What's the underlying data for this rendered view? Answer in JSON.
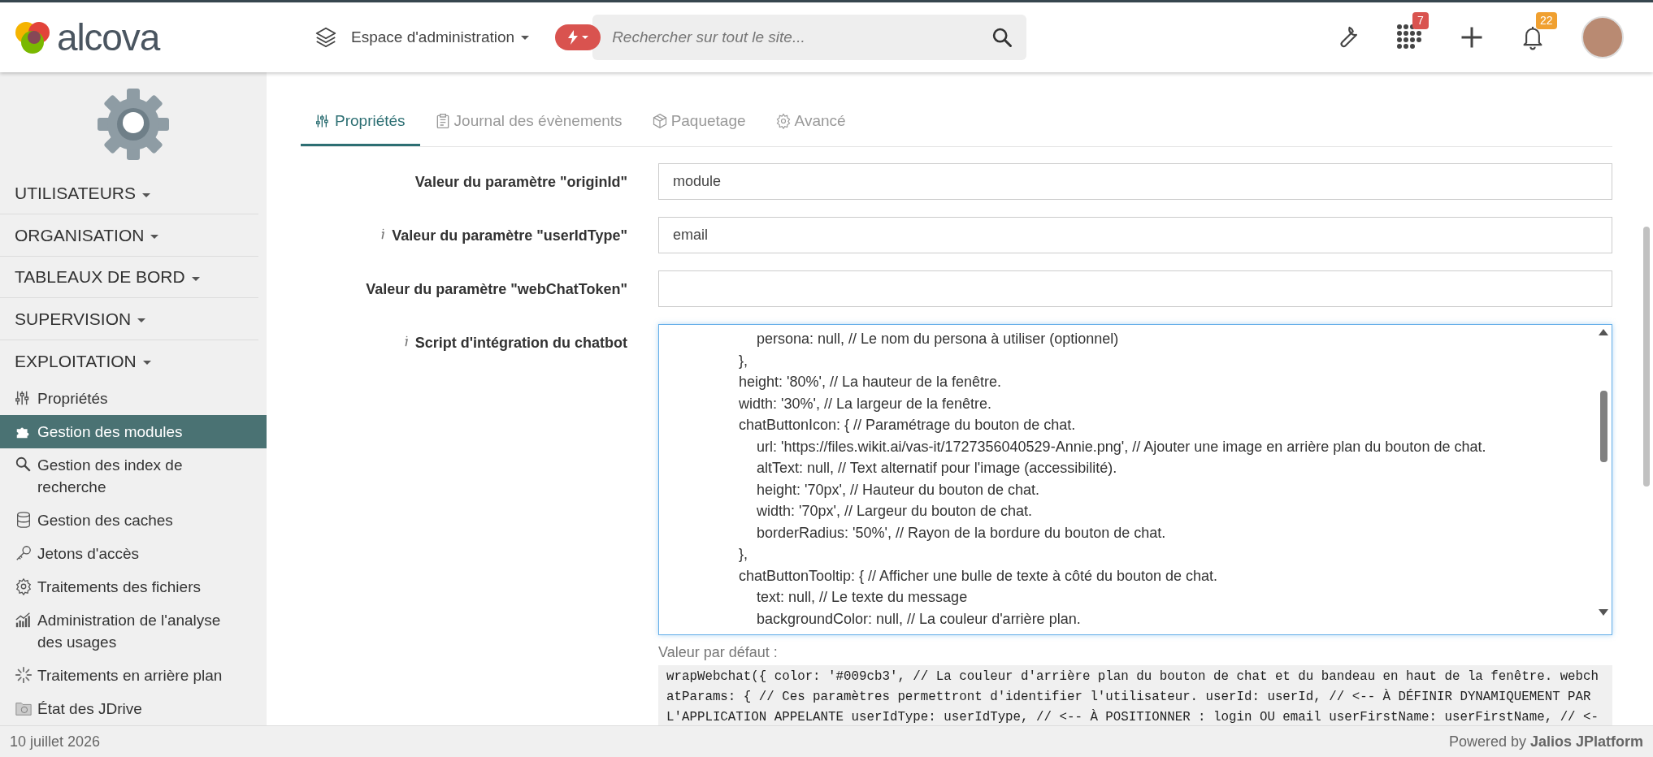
{
  "header": {
    "logo_text": "alcova",
    "space_menu": "Espace d'administration",
    "search_placeholder": "Rechercher sur tout le site...",
    "apps_badge": "7",
    "notifications_badge": "22"
  },
  "sidebar": {
    "sections": [
      {
        "label": "UTILISATEURS"
      },
      {
        "label": "ORGANISATION"
      },
      {
        "label": "TABLEAUX DE BORD"
      },
      {
        "label": "SUPERVISION"
      },
      {
        "label": "EXPLOITATION"
      }
    ],
    "items": [
      {
        "label": "Propriétés",
        "selected": false
      },
      {
        "label": "Gestion des modules",
        "selected": true
      },
      {
        "label": "Gestion des index de recherche",
        "selected": false
      },
      {
        "label": "Gestion des caches",
        "selected": false
      },
      {
        "label": "Jetons d'accès",
        "selected": false
      },
      {
        "label": "Traitements des fichiers",
        "selected": false
      },
      {
        "label": "Administration de l'analyse des usages",
        "selected": false
      },
      {
        "label": "Traitements en arrière plan",
        "selected": false
      },
      {
        "label": "État des JDrive",
        "selected": false
      }
    ]
  },
  "tabs": [
    {
      "label": "Propriétés",
      "selected": true
    },
    {
      "label": "Journal des évènements",
      "selected": false
    },
    {
      "label": "Paquetage",
      "selected": false
    },
    {
      "label": "Avancé",
      "selected": false
    }
  ],
  "fields": [
    {
      "label": "Valeur du paramètre \"originId\"",
      "info": false,
      "value": "module"
    },
    {
      "label": "Valeur du paramètre \"userIdType\"",
      "info": true,
      "value": "email"
    },
    {
      "label": "Valeur du paramètre \"webChatToken\"",
      "info": false
    }
  ],
  "script": {
    "label": "Script d'intégration du chatbot",
    "info": true,
    "value": "\t\t\t\t\tpersona: null, // Le nom du persona à utiliser (optionnel)\n\t\t\t\t},\n\t\t\t\theight: '80%', // La hauteur de la fenêtre.\n\t\t\t\twidth: '30%', // La largeur de la fenêtre.\n\t\t\t\tchatButtonIcon: { // Paramétrage du bouton de chat.\n\t\t\t\t\turl: 'https://files.wikit.ai/vas-it/1727356040529-Annie.png', // Ajouter une image en arrière plan du bouton de chat.\n\t\t\t\t\taltText: null, // Text alternatif pour l'image (accessibilité).\n\t\t\t\t\theight: '70px', // Hauteur du bouton de chat.\n\t\t\t\t\twidth: '70px', // Largeur du bouton de chat.\n\t\t\t\t\tborderRadius: '50%', // Rayon de la bordure du bouton de chat.\n\t\t\t\t},\n\t\t\t\tchatButtonTooltip: { // Afficher une bulle de texte à côté du bouton de chat.\n\t\t\t\t\ttext: null, // Le texte du message\n\t\t\t\t\tbackgroundColor: null, // La couleur d'arrière plan."
  },
  "default": {
    "label": "Valeur par défaut :",
    "code": "wrapWebchat({ color: '#009cb3', // La couleur d'arrière plan du bouton de chat et du bandeau en haut de la fenêtre. webchatParams: { // Ces paramètres permettront d'identifier l'utilisateur. userId: userId, // <-- À DÉFINIR DYNAMIQUEMENT PAR L'APPLICATION APPELANTE userIdType: userIdType, // <-- À POSITIONNER : login OU email userFirstName: userFirstName, // <-"
  },
  "footer": {
    "date": "10 juillet 2026",
    "powered": "Powered by **Jalios JPlatform**"
  }
}
